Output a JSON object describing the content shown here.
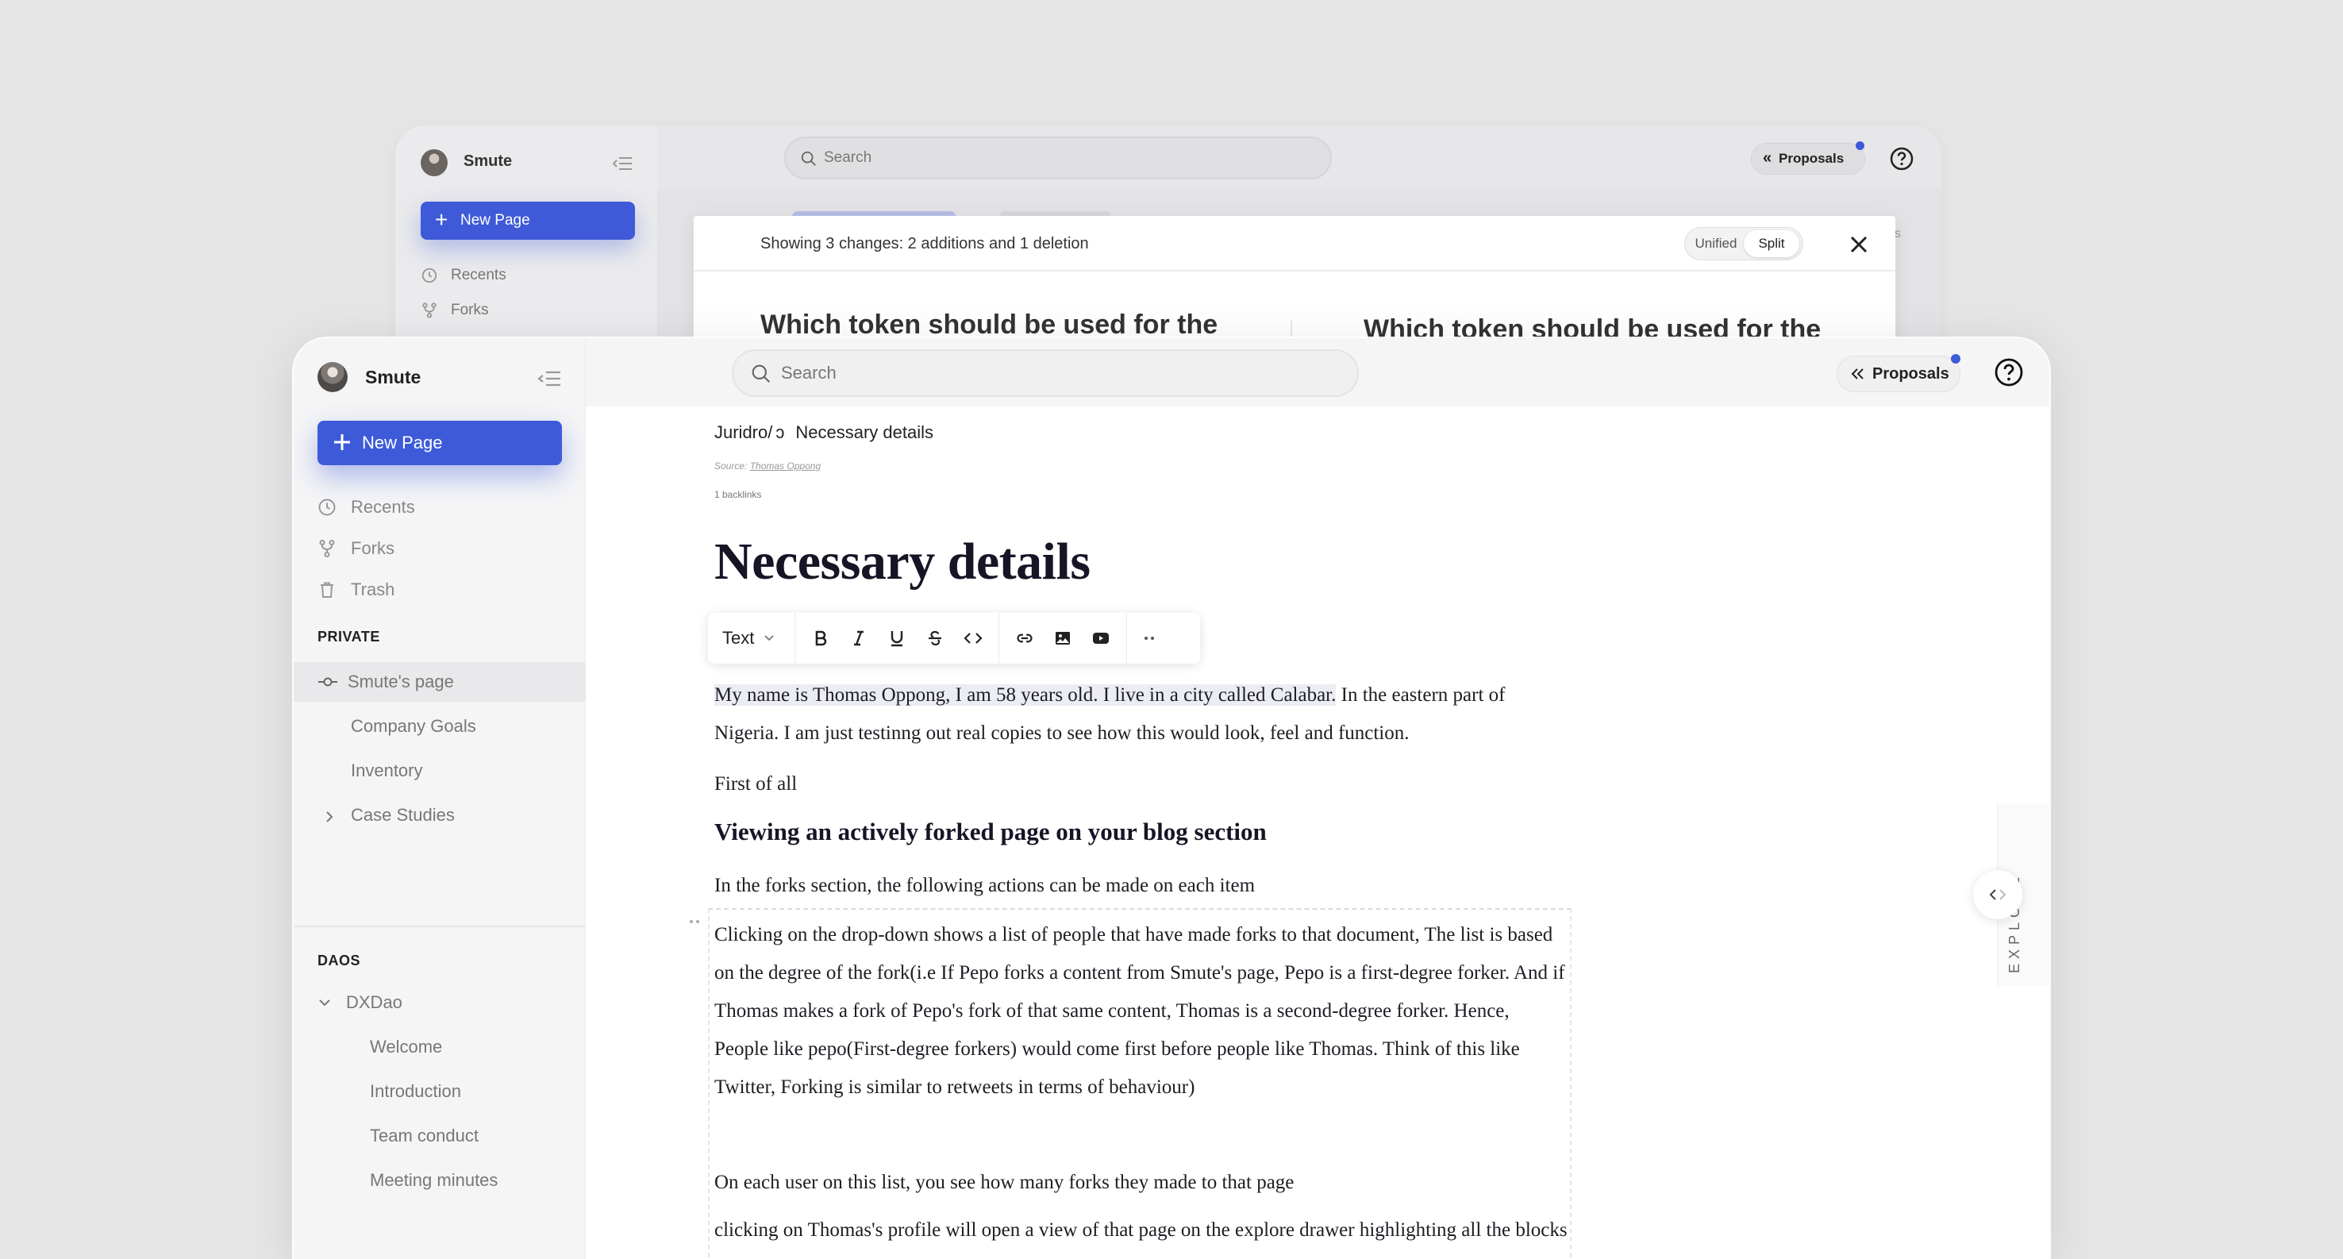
{
  "back_window": {
    "user": "Smute",
    "new_page_label": "New Page",
    "nav": [
      "Recents",
      "Forks"
    ],
    "search_placeholder": "Search",
    "proposals_label": "Proposals",
    "diff": {
      "summary": "Showing 3 changes: 2 additions and 1 deletion",
      "toggle": [
        "Unified",
        "Split"
      ],
      "left_title": "Which token should be used for the",
      "right_title": "Which token should be used for the",
      "edge_label": "es"
    }
  },
  "sidebar": {
    "user": "Smute",
    "new_page_label": "New Page",
    "nav": [
      "Recents",
      "Forks",
      "Trash"
    ],
    "private_label": "PRIVATE",
    "private_page": "Smute's page",
    "private_children": [
      "Company Goals",
      "Inventory",
      "Case Studies"
    ],
    "daos_label": "DAOS",
    "dao_name": "DXDao",
    "dao_children": [
      "Welcome",
      "Introduction",
      "Team conduct",
      "Meeting minutes"
    ]
  },
  "topbar": {
    "search_placeholder": "Search",
    "proposals_label": "Proposals"
  },
  "document": {
    "breadcrumb_root": "Juridro/",
    "breadcrumb_page": "Necessary details",
    "source_label": "Source:",
    "source_author": "Thomas Oppong",
    "backlinks": "1 backlinks",
    "title": "Necessary details",
    "format_type": "Text",
    "highlighted_text": "My name is Thomas Oppong, I am 58 years old. I live in a city called Calabar.",
    "para1_rest": " In the eastern part of Nigeria. I am just testinng out real copies to see how this would look, feel and function.",
    "para2": "First of all",
    "heading": "Viewing an actively forked page on your blog section",
    "para3": "In the forks section, the following actions can be made on each item",
    "para4": "Clicking on the drop-down shows a list of people that have made forks to that document, The list is based on the degree of the fork(i.e If Pepo forks a content from Smute's page, Pepo is a first-degree forker. And if Thomas makes a fork of Pepo's fork of that same content, Thomas is a second-degree forker. Hence, People like pepo(First-degree forkers) would come first before people like Thomas. Think of this like Twitter, Forking is similar to retweets in terms of behaviour)",
    "para5": "On each user on this list, you see how many forks they made to that page",
    "para6": "clicking on Thomas's profile will open a view of that page on the explore drawer highlighting all the blocks forked by that user"
  },
  "explore_label": "EXPLORE",
  "colors": {
    "accent": "#3d5bd9",
    "sidebar_bg": "#f5f5f6",
    "page_bg": "#e5e5e6"
  }
}
